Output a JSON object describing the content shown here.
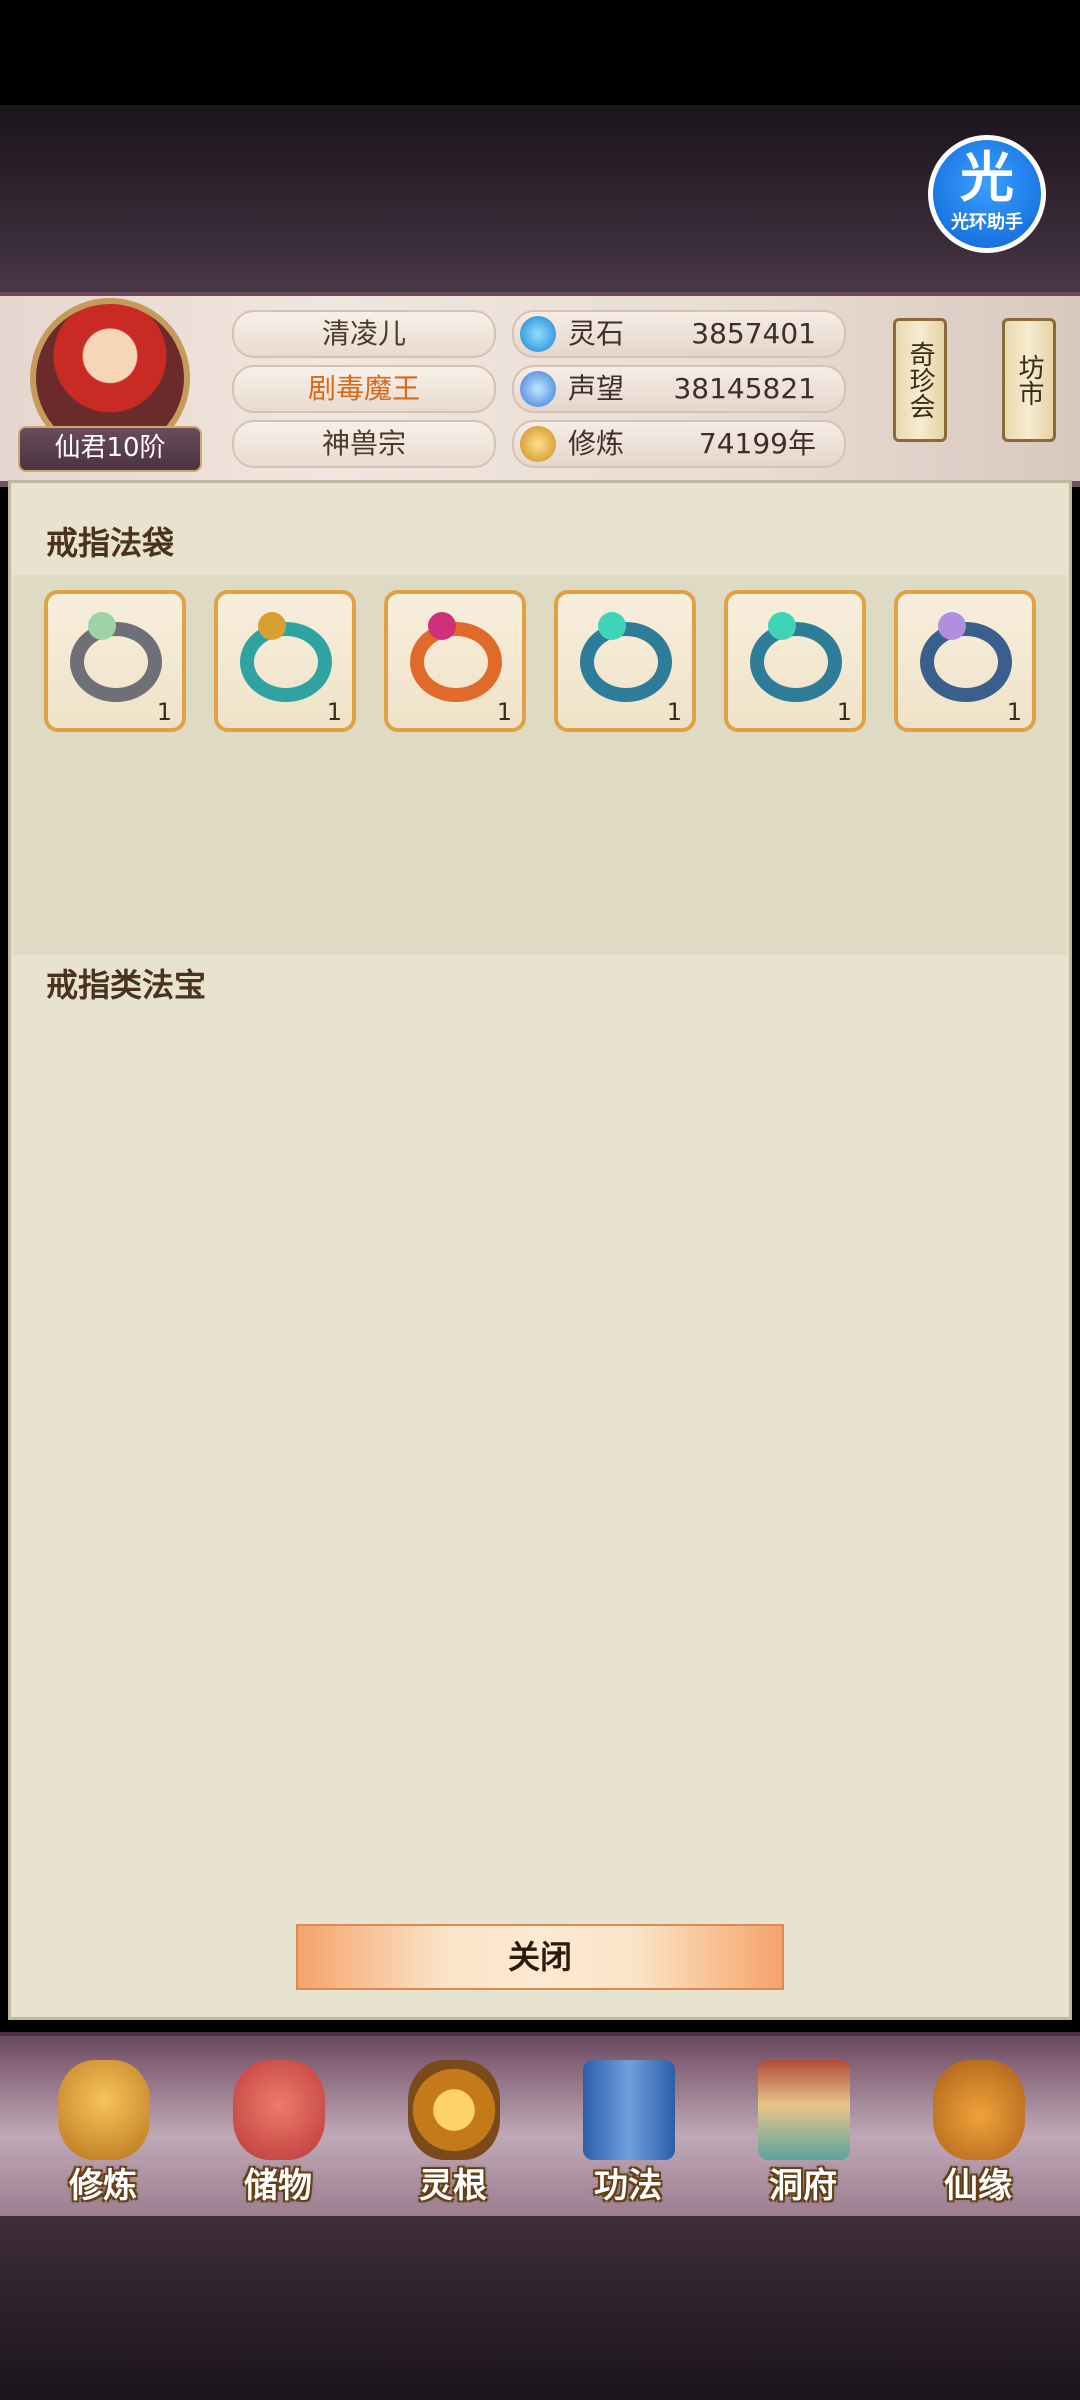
{
  "helper": {
    "big": "光",
    "small": "光环助手"
  },
  "player": {
    "rank": "仙君10阶",
    "name": "清凌儿",
    "title": "剧毒魔王",
    "sect": "神兽宗"
  },
  "stats": [
    {
      "label": "灵石",
      "value": "3857401",
      "icon": "spirit-stone-icon"
    },
    {
      "label": "声望",
      "value": "38145821",
      "icon": "reputation-icon"
    },
    {
      "label": "修炼",
      "value": "74199年",
      "icon": "cultivation-icon"
    }
  ],
  "shortcuts": {
    "treasure_fair": "奇珍会",
    "market": "坊市"
  },
  "sections": {
    "ring_bag": "戒指法袋",
    "ring_treasures": "戒指类法宝"
  },
  "rings": [
    {
      "qty": "1",
      "color": "#6f6f78",
      "gem": "#9fd3a7"
    },
    {
      "qty": "1",
      "color": "#2fa3a2",
      "gem": "#d8a030"
    },
    {
      "qty": "1",
      "color": "#e06a2a",
      "gem": "#d0307a"
    },
    {
      "qty": "1",
      "color": "#2d7c98",
      "gem": "#3fd3b8"
    },
    {
      "qty": "1",
      "color": "#2d7c98",
      "gem": "#3fd3b8"
    },
    {
      "qty": "1",
      "color": "#3b5f8c",
      "gem": "#b08fe0"
    }
  ],
  "close_label": "关闭",
  "nav": [
    {
      "label": "修炼"
    },
    {
      "label": "储物"
    },
    {
      "label": "灵根"
    },
    {
      "label": "功法"
    },
    {
      "label": "洞府"
    },
    {
      "label": "仙缘"
    }
  ]
}
